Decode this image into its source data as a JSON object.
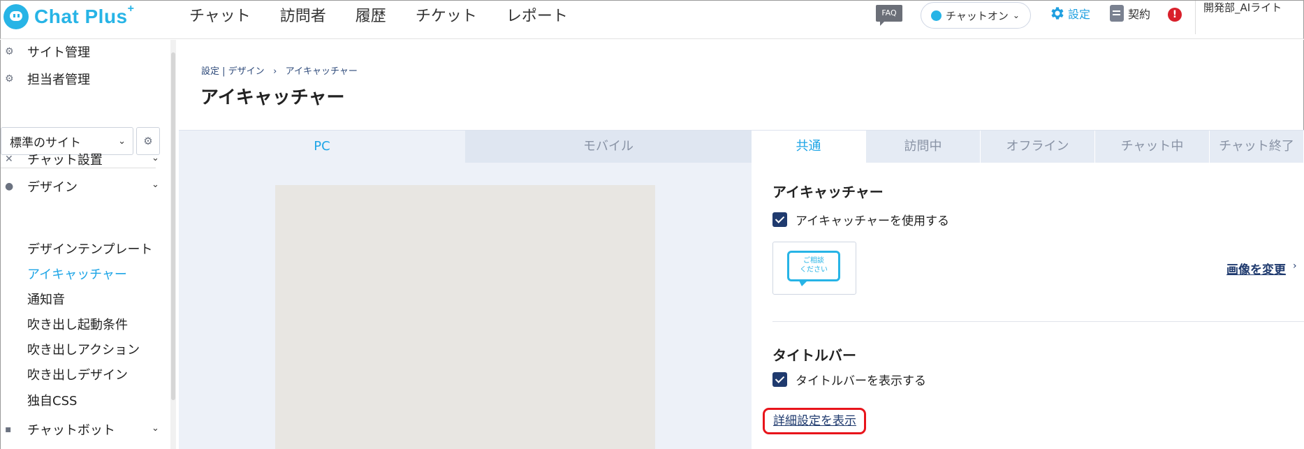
{
  "app": {
    "logo_text": "Chat Plus",
    "logo_sup": "+"
  },
  "nav": {
    "items": [
      "チャット",
      "訪問者",
      "履歴",
      "チケット",
      "レポート"
    ]
  },
  "header": {
    "faq_label": "FAQ",
    "chat_status": "チャットオン",
    "settings_label": "設定",
    "contract_label": "契約",
    "alert_symbol": "!",
    "user_name": "開発部_AIライト"
  },
  "sidebar": {
    "site_admin": "サイト管理",
    "staff_admin": "担当者管理",
    "site_select": "標準のサイト",
    "chat_setup": "チャット設置",
    "design": "デザイン",
    "design_items": [
      "デザインテンプレート",
      "アイキャッチャー",
      "通知音",
      "吹き出し起動条件",
      "吹き出しアクション",
      "吹き出しデザイン",
      "独自CSS"
    ],
    "chatbot": "チャットボット"
  },
  "page": {
    "breadcrumb_root": "設定 | デザイン",
    "breadcrumb_sep": "›",
    "breadcrumb_current": "アイキャッチャー",
    "title": "アイキャッチャー"
  },
  "device_tabs": {
    "pc": "PC",
    "mobile": "モバイル"
  },
  "state_tabs": [
    "共通",
    "訪問中",
    "オフライン",
    "チャット中",
    "チャット終了"
  ],
  "settings": {
    "eyecatcher_title": "アイキャッチャー",
    "use_eyecatcher": "アイキャッチャーを使用する",
    "bubble_text": "ご相談\nください",
    "change_image": "画像を変更",
    "titlebar_title": "タイトルバー",
    "show_titlebar": "タイトルバーを表示する",
    "show_details": "詳細設定を表示"
  },
  "colors": {
    "accent": "#27b4e6",
    "navy": "#1f3a6e",
    "highlight": "#e8141b"
  }
}
